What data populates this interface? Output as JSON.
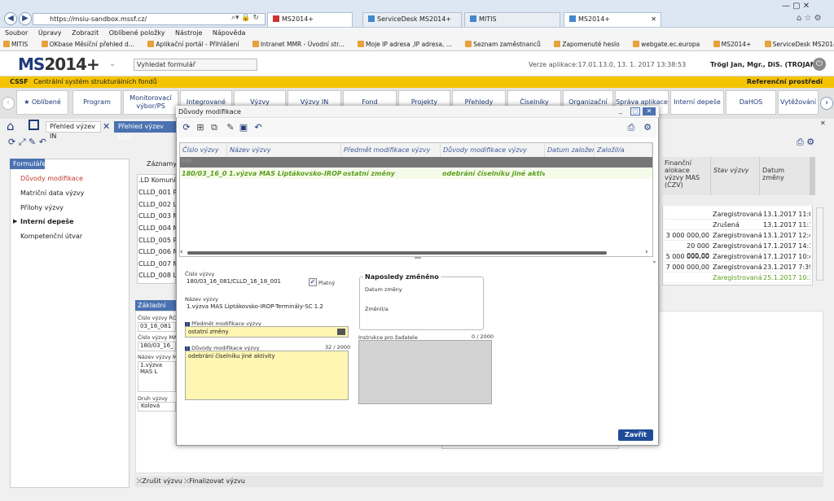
{
  "browser": {
    "url": "https://msiu-sandbox.mssf.cz/",
    "tabs": [
      "MS2014+",
      "ServiceDesk MS2014+",
      "MITIS",
      "MS2014+"
    ],
    "menu": [
      "Soubor",
      "Úpravy",
      "Zobrazit",
      "Oblíbené položky",
      "Nástroje",
      "Nápověda"
    ],
    "bookmarks": [
      "MITIS",
      "OKbase Měsíční přehled d...",
      "Aplikační portál - Přihlášení",
      "Intranet MMR - Úvodní str...",
      "Moje IP adresa ,IP adresa, ...",
      "Seznam zaměstnanců",
      "Zapomenuté heslo",
      "webgate.ec.europa",
      "MS2014+",
      "ServiceDesk MS2014+"
    ]
  },
  "app": {
    "logo_ms": "MS",
    "logo_rest": "2014+",
    "search_placeholder": "Vyhledat formulář",
    "version": "Verze aplikace:17.01.13.0, 13. 1. 2017 13:38:53",
    "user": "Trögl Jan, Mgr., DiS. (TROJAN)",
    "system_name": "CSSF",
    "system_full": "Centrální systém strukturálních fondů",
    "environment": "Referenční prostředí"
  },
  "modules": [
    "Oblíbené",
    "Program",
    "Monitorovací výbor/PS",
    "Integrované",
    "Výzvy",
    "Výzvy IN",
    "Fond",
    "Projekty",
    "Přehledy",
    "Číselníky",
    "Organizační",
    "Správa aplikace",
    "Interní depeše",
    "DaHOS",
    "Vytěžování"
  ],
  "page_tabs": [
    "Přehled výzev IN",
    "Přehled výzev MAS"
  ],
  "left_panel": {
    "header": "Formuláře",
    "items": [
      "Důvody modifikace",
      "Matriční data výzvy",
      "Přílohy výzvy",
      "Interní depeše",
      "Kompetenční útvar"
    ]
  },
  "bg_list": {
    "label": "Záznamy s",
    "rows": [
      ".LD Komunitn",
      "CLLD_001 P",
      "CLLD_002 L",
      "CLLD_003 M",
      "CLLD_004 M",
      "CLLD_005 P",
      "CLLD_006 M",
      "CLLD_007 M",
      "CLLD_008 L"
    ]
  },
  "bg_form": {
    "section": "Základní údaj",
    "cislo_ro_label": "Číslo výzvy ŘO",
    "cislo_ro": "03_16_081",
    "cislo_mas_label": "Číslo výzvy MAS",
    "cislo_mas": "180/03_16_",
    "nazev_label": "Název výzvy MAS",
    "nazev": "1.výzva MAS L",
    "druh_label": "Druh výzvy",
    "druh": "Kolová"
  },
  "right_grid": {
    "headers": [
      "Finanční alokace výzvy MAS (CZV)",
      "Stav výzvy",
      "Datum změny"
    ],
    "rows": [
      {
        "amount": "",
        "state": "Zaregistrovaná",
        "date": "13.1.2017 11:02"
      },
      {
        "amount": "",
        "state": "Zrušená",
        "date": "13.1.2017 11:16"
      },
      {
        "amount": "3 000 000,00",
        "state": "Zaregistrovaná",
        "date": "13.1.2017 12:49"
      },
      {
        "amount": "20 000 000,00",
        "state": "Zaregistrovaná",
        "date": "17.1.2017 14:14"
      },
      {
        "amount": "5 000 000,00",
        "state": "Zaregistrovaná",
        "date": "17.1.2017 10:47"
      },
      {
        "amount": "7 000 000,00",
        "state": "Zaregistrovaná",
        "date": "23.1.2017 7:39:"
      },
      {
        "amount": "",
        "state": "Zaregistrovaná",
        "date": "25.1.2017 10:34"
      }
    ]
  },
  "bottom_buttons": [
    "Zrušit výzvu",
    "Finalizovat výzvu"
  ],
  "dialog": {
    "title": "Důvody modifikace",
    "columns": [
      "Číslo výzvy",
      "Název výzvy",
      "Předmět modifikace výzvy",
      "Důvody modifikace výzvy",
      "Datum založení",
      "Založil/a"
    ],
    "filter_placeholder": "Filtr...",
    "rows": [
      {
        "cislo": "180/03_16_08:",
        "nazev": "1.výzva MAS Liptákovsko-IROP-Termi",
        "predmet": "ostatní změny",
        "duvody": "odebrání číselníku jiné aktivity",
        "datum": "",
        "zalozil": ""
      }
    ],
    "detail": {
      "cislo_label": "Číslo výzvy",
      "cislo": "180/03_16_081/CLLD_16_18_001",
      "platny_label": "Platný",
      "nazev_label": "Název výzvy",
      "nazev": "1.výzva MAS Liptákovsko-IROP-Terminály-SC 1.2",
      "predmet_label": "Předmět modifikace výzvy",
      "predmet": "ostatní změny",
      "duvody_label": "Důvody modifikace výzvy",
      "duvody_count": "32 / 2000",
      "duvody": "odebrání číselníku jiné aktivity",
      "naposledy_title": "Naposledy změněno",
      "datum_zmeny_label": "Datum změny",
      "zmenil_label": "Změnil/a",
      "instrukce_label": "Instrukce pro žadatele",
      "instrukce_count": "0 / 2000"
    },
    "close_label": "Zavřít"
  }
}
